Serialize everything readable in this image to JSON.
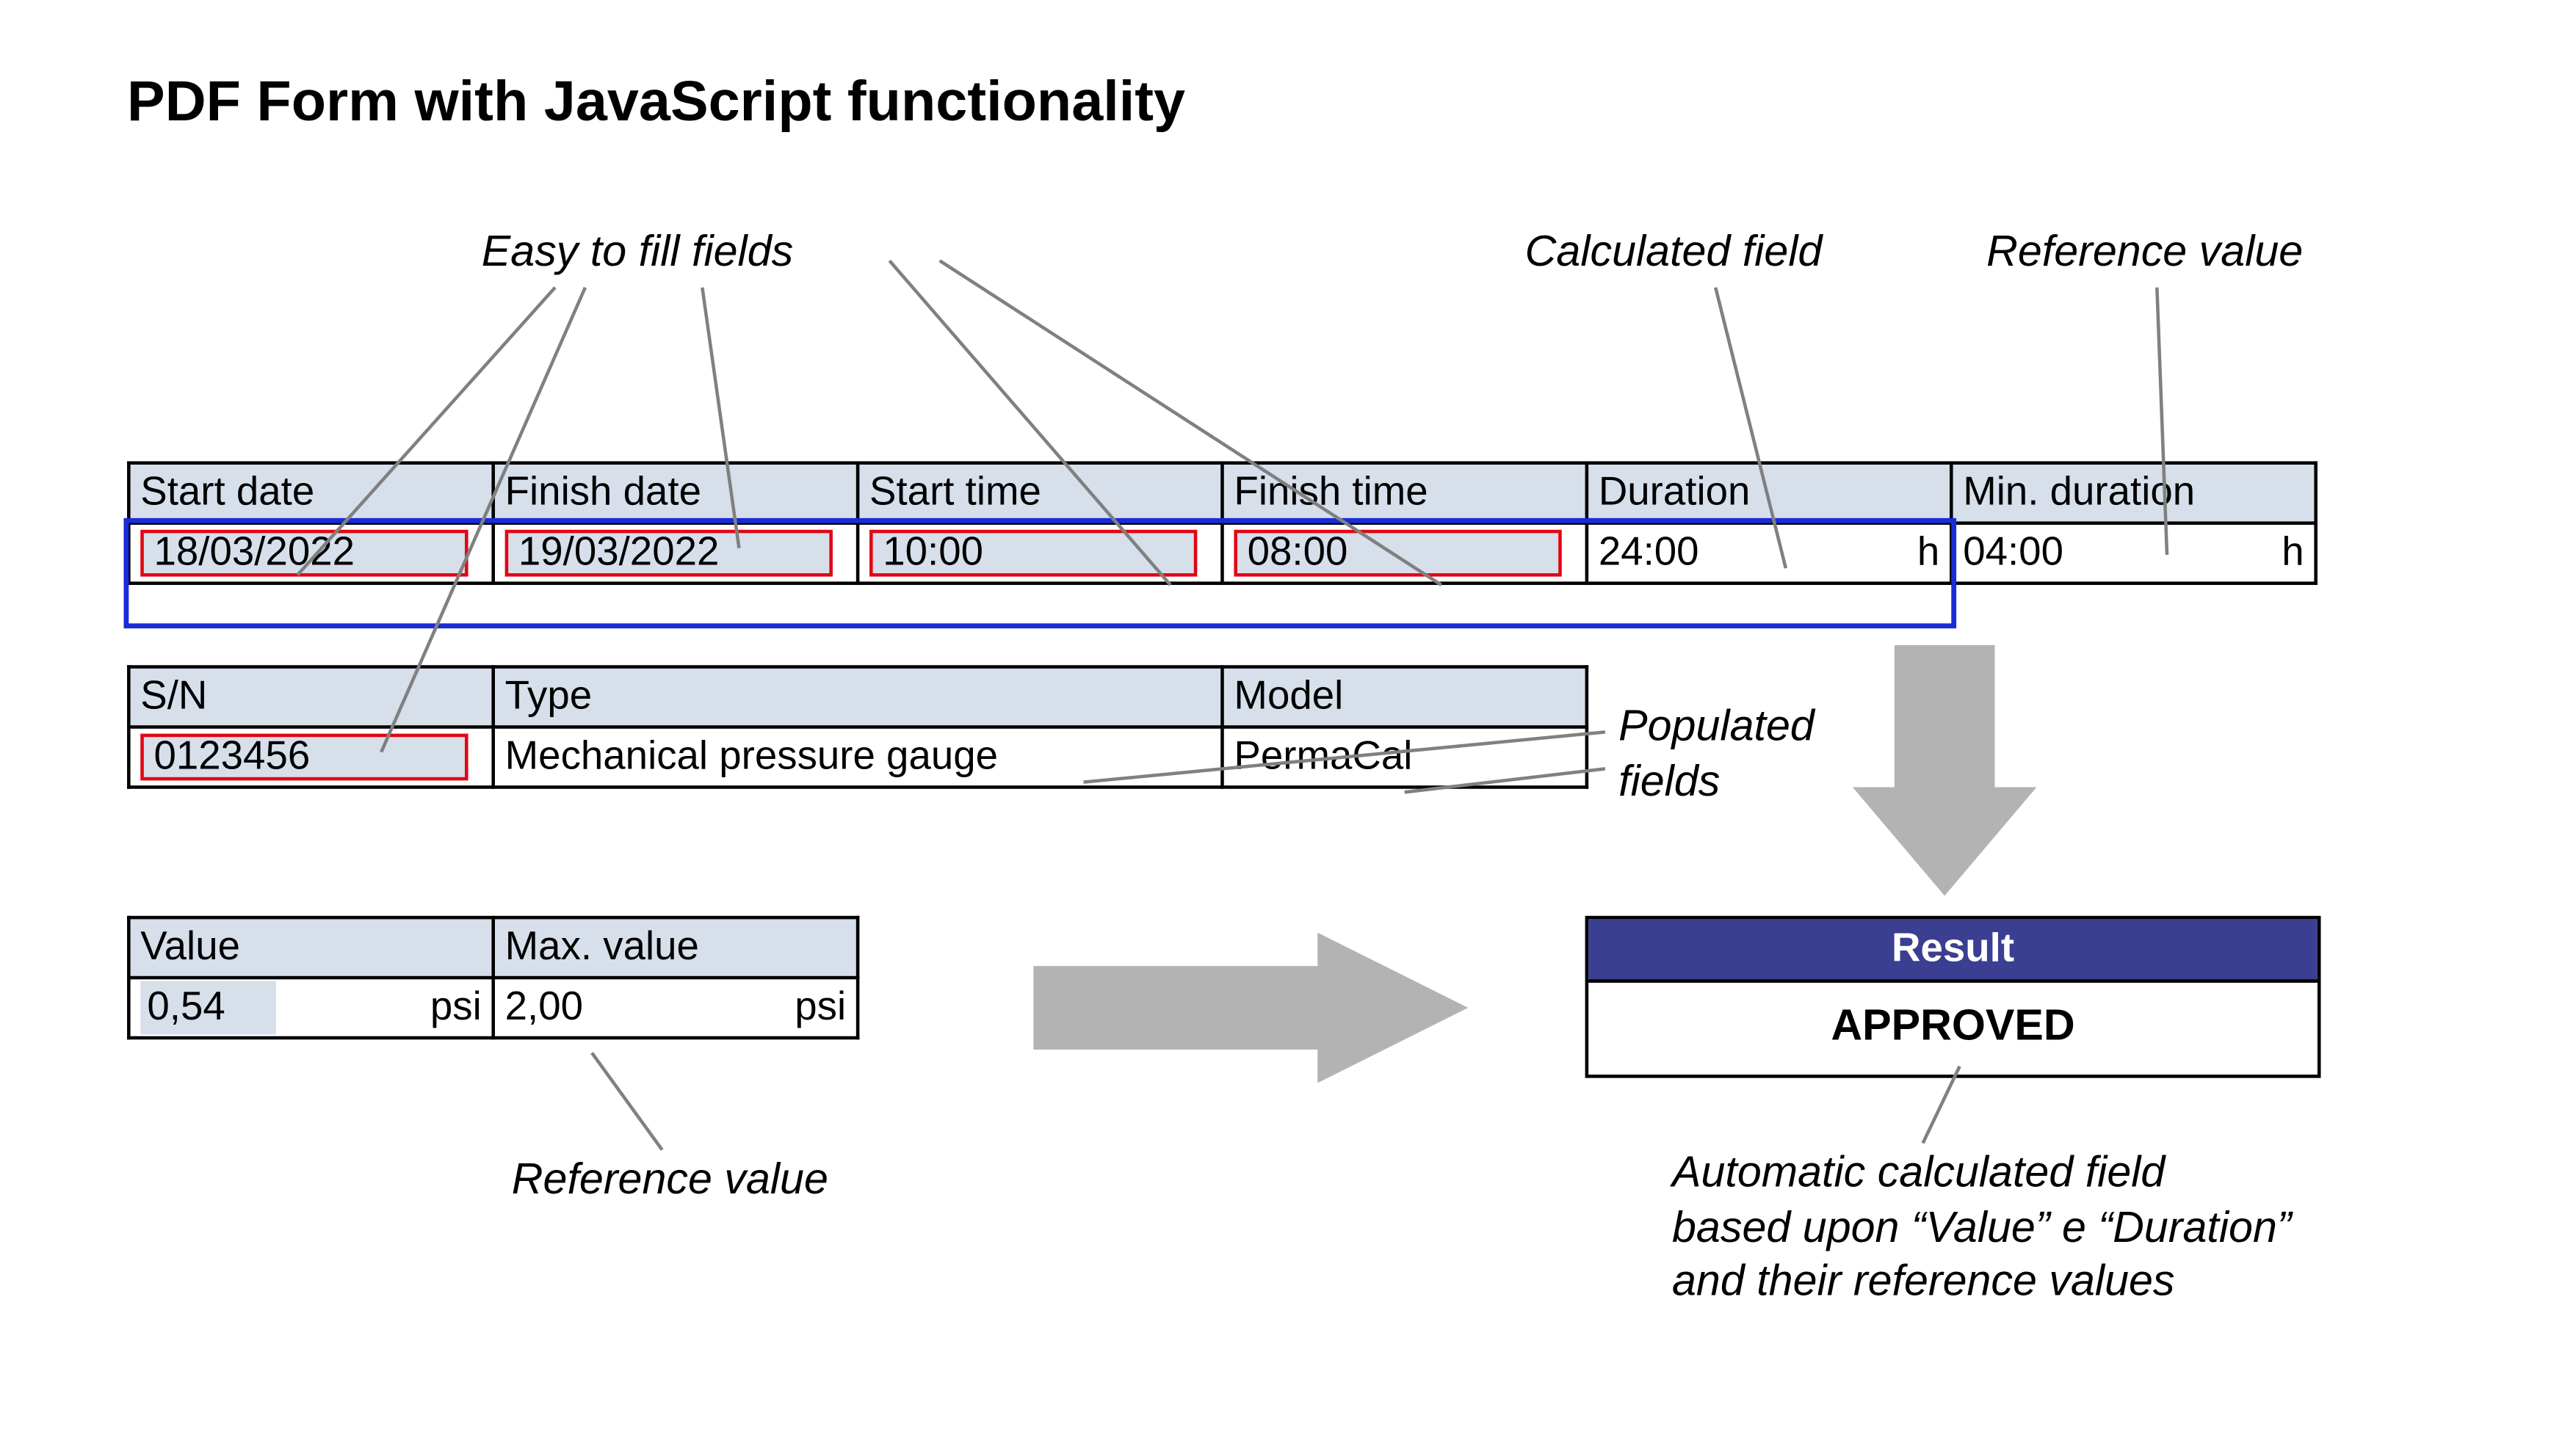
{
  "title": "PDF Form with JavaScript functionality",
  "annotations": {
    "easy_fill": "Easy to fill fields",
    "calculated_field": "Calculated field",
    "reference_value_top": "Reference value",
    "populated_fields": "Populated fields",
    "reference_value_bottom": "Reference value",
    "result_footnote_l1": "Automatic calculated field",
    "result_footnote_l2": "based upon “Value” e “Duration”",
    "result_footnote_l3": "and their reference values"
  },
  "table1": {
    "headers": {
      "start_date": "Start date",
      "finish_date": "Finish date",
      "start_time": "Start time",
      "finish_time": "Finish time",
      "duration": "Duration",
      "min_duration": "Min. duration"
    },
    "values": {
      "start_date": "18/03/2022",
      "finish_date": "19/03/2022",
      "start_time": "10:00",
      "finish_time": "08:00",
      "duration": "24:00",
      "duration_unit": "h",
      "min_duration": "04:00",
      "min_duration_unit": "h"
    }
  },
  "table2": {
    "headers": {
      "sn": "S/N",
      "type": "Type",
      "model": "Model"
    },
    "values": {
      "sn": "0123456",
      "type": "Mechanical pressure gauge",
      "model": "PermaCal"
    }
  },
  "table3": {
    "headers": {
      "value": "Value",
      "max_value": "Max. value"
    },
    "values": {
      "value": "0,54",
      "value_unit": "psi",
      "max_value": "2,00",
      "max_value_unit": "psi"
    }
  },
  "result": {
    "header": "Result",
    "value": "APPROVED"
  }
}
